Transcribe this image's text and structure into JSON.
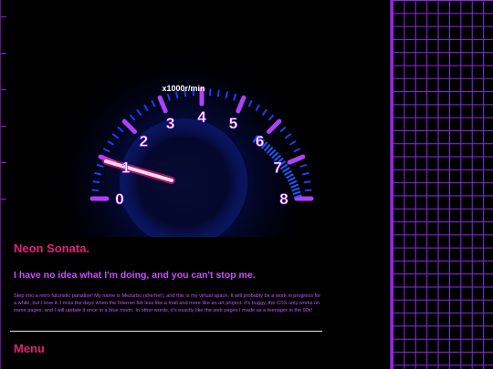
{
  "site": {
    "title": "Neon Sonata.",
    "tagline": "I have no idea what I'm doing, and you can't stop me.",
    "intro": "Step into a retro futuristic paradise! My name is Mezurbo (she/her), and this is my virtual space. It will probably be a work in progress for a while, but I love it. I miss the days when the Internet felt less like a mall and more like an art project. It's buggy, the CSS only works on some pages, and I will update it once in a blue moon. In other words, it's exactly like the web pages I made as a teenager in the 90s!",
    "menu_heading": "Menu"
  },
  "gauge": {
    "unit_label": "x1000r/min",
    "tick_labels": [
      "0",
      "1",
      "2",
      "3",
      "4",
      "5",
      "6",
      "7",
      "8"
    ],
    "colors": {
      "accent_purple": "#a020f0",
      "tick_violet": "#b040ff",
      "scale_blue": "#1e3cff",
      "label_white": "#ffffff"
    }
  },
  "colors": {
    "title_pink": "#e0217c",
    "text_violet": "#c850ff",
    "grid_purple": "#8a2be2"
  }
}
